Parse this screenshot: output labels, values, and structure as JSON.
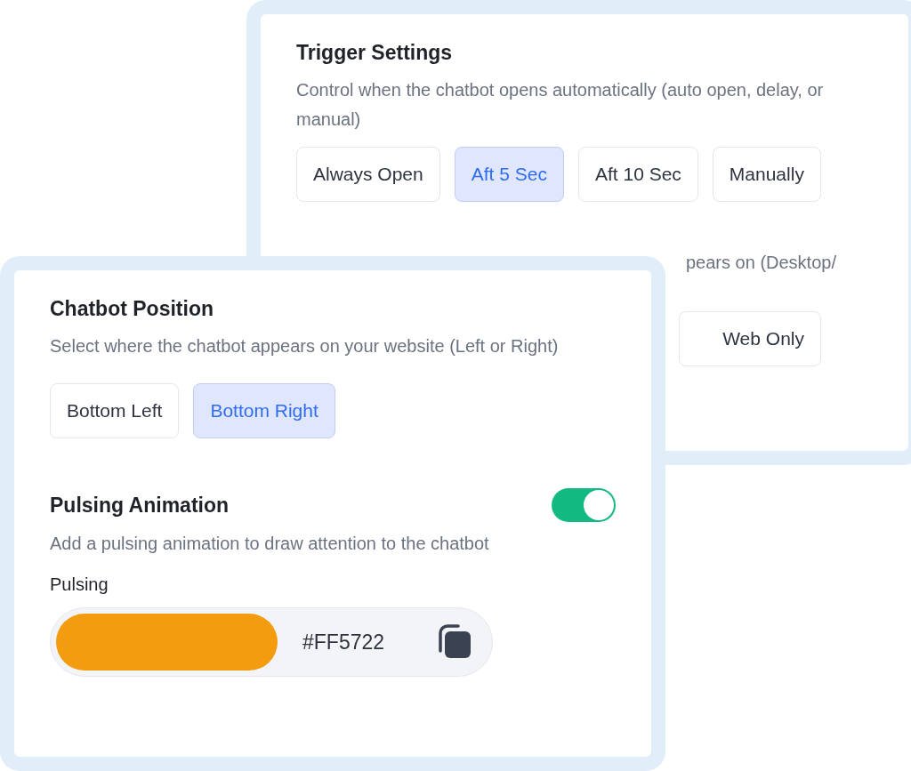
{
  "back_card": {
    "title": "Trigger Settings",
    "description": "Control when the chatbot opens automatically (auto open, delay, or manual)",
    "options": [
      {
        "label": "Always Open",
        "selected": false
      },
      {
        "label": "Aft 5 Sec",
        "selected": true
      },
      {
        "label": "Aft 10 Sec",
        "selected": false
      },
      {
        "label": "Manually",
        "selected": false
      }
    ],
    "partial_description": "pears on (Desktop/",
    "partial_options": [
      {
        "label": "Web Only",
        "selected": false
      }
    ]
  },
  "front_card": {
    "title": "Chatbot Position",
    "description": "Select where the chatbot appears on your website (Left or Right)",
    "options": [
      {
        "label": "Bottom Left",
        "selected": false
      },
      {
        "label": "Bottom Right",
        "selected": true
      }
    ],
    "pulsing": {
      "title": "Pulsing Animation",
      "on": true,
      "description": "Add a pulsing animation to draw attention to the chatbot",
      "field_label": "Pulsing",
      "color_field": {
        "color": "#f39c0f",
        "value": "#FF5722"
      }
    }
  }
}
